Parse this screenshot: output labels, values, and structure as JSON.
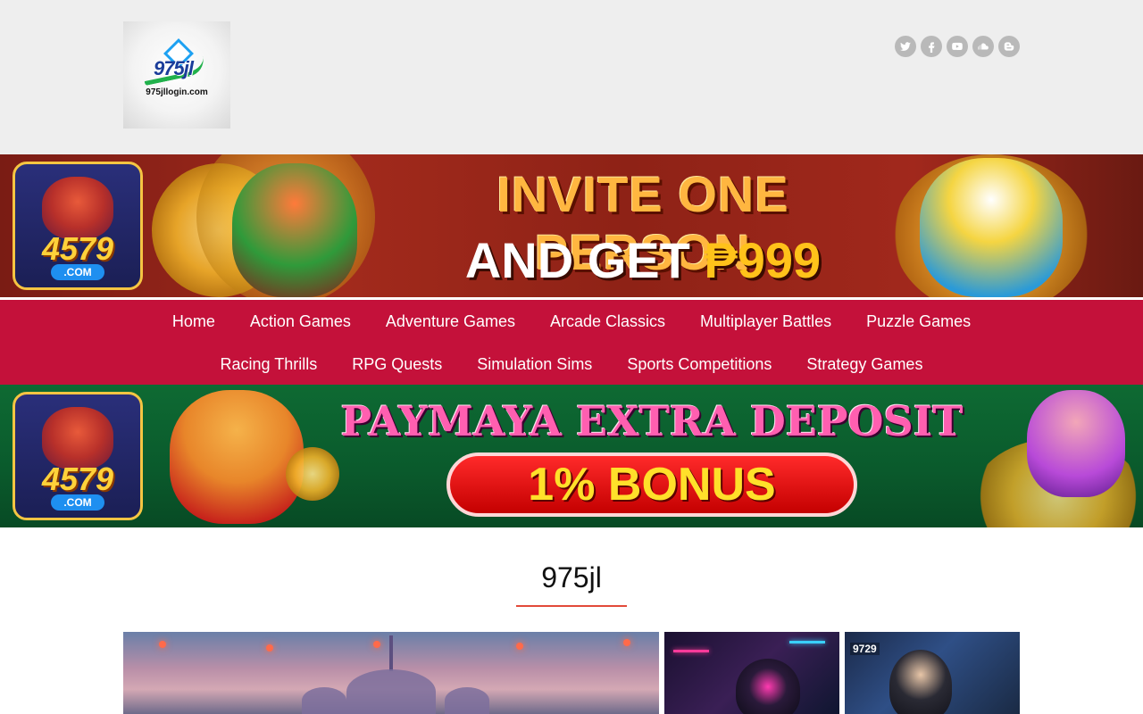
{
  "header": {
    "logo_text": "975jl",
    "logo_url": "975jllogin.com",
    "social": [
      "twitter-icon",
      "facebook-icon",
      "youtube-icon",
      "soundcloud-icon",
      "blogger-icon"
    ]
  },
  "banner_top": {
    "brand_number": "4579",
    "brand_suffix": ".COM",
    "headline": "INVITE ONE PERSON",
    "subline_prefix": "AND GET ",
    "subline_amount": "₱999"
  },
  "nav": {
    "row1": [
      "Home",
      "Action Games",
      "Adventure Games",
      "Arcade Classics",
      "Multiplayer Battles",
      "Puzzle Games"
    ],
    "row2": [
      "Racing Thrills",
      "RPG Quests",
      "Simulation Sims",
      "Sports Competitions",
      "Strategy Games"
    ]
  },
  "banner_bottom": {
    "brand_number": "4579",
    "brand_suffix": ".COM",
    "headline": "PAYMAYA EXTRA DEPOSIT",
    "bonus": "1% BONUS"
  },
  "section": {
    "title": "975jl"
  },
  "cards": {
    "card_c_tag": "9729"
  },
  "colors": {
    "header_bg": "#eeeeee",
    "nav_bg": "#c4113a",
    "title_underline": "#e24a3a",
    "social_icon_bg": "#b9b9b9"
  }
}
